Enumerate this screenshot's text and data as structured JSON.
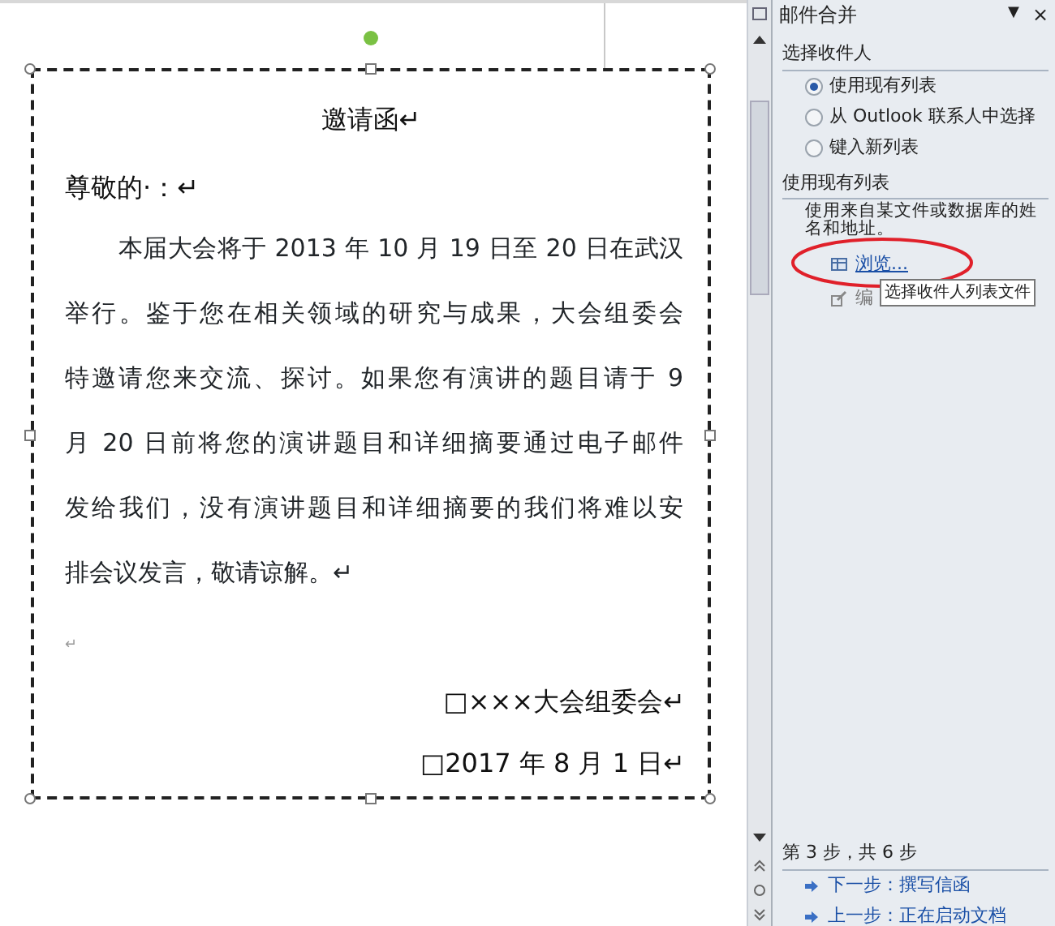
{
  "document": {
    "title": "邀请函↵",
    "salutation": "尊敬的·：↵",
    "body_lines": [
      "本届大会将于 2013 年 10 月 19 日至 20 日在武汉",
      "举行。鉴于您在相关领域的研究与成果，大会组委会",
      "特邀请您来交流、探讨。如果您有演讲的题目请于 9",
      "月 20 日前将您的演讲题目和详细摘要通过电子邮件",
      "发给我们，没有演讲题目和详细摘要的我们将难以安",
      "排会议发言，敬请谅解。↵"
    ],
    "empty_line": "↵",
    "signature": "□×××大会组委会↵",
    "date": "□2017 年 8 月 1 日↵"
  },
  "task_pane": {
    "title": "邮件合并",
    "menu_glyph": "▼",
    "close_glyph": "×",
    "section_1": "选择收件人",
    "options": [
      {
        "label": "使用现有列表",
        "selected": true
      },
      {
        "label": "从 Outlook 联系人中选择",
        "selected": false
      },
      {
        "label": "键入新列表",
        "selected": false
      }
    ],
    "section_2": "使用现有列表",
    "description": "使用来自某文件或数据库的姓名和地址。",
    "browse_link": "浏览...",
    "edit_link": "编",
    "tooltip": "选择收件人列表文件",
    "step": "第 3 步，共 6 步",
    "next": "下一步：撰写信函",
    "previous": "上一步：正在启动文档"
  }
}
